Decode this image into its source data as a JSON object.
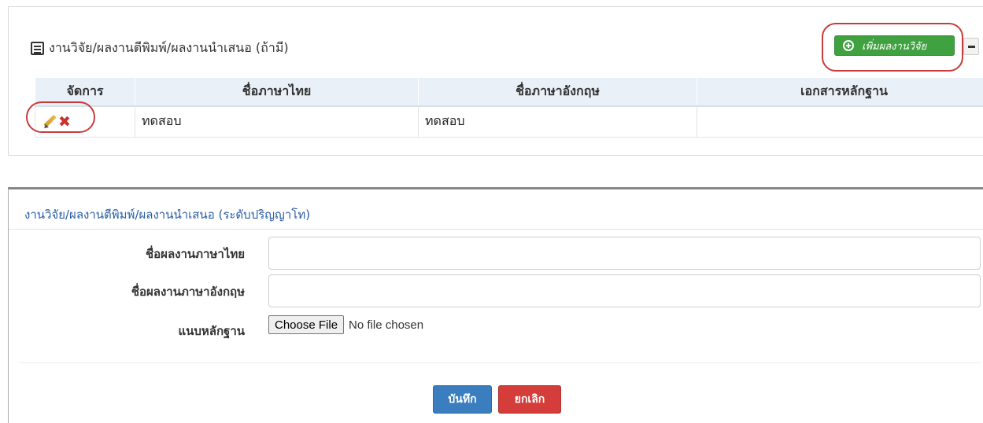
{
  "panel": {
    "title": "งานวิจัย/ผลงานตีพิมพ์/ผลงานนำเสนอ (ถ้ามี)",
    "add_button_label": "เพิ่มผลงานวิจัย",
    "table": {
      "headers": [
        "จัดการ",
        "ชื่อภาษาไทย",
        "ชื่อภาษาอังกฤษ",
        "เอกสารหลักฐาน"
      ],
      "rows": [
        {
          "thai_name": "ทดสอบ",
          "english_name": "ทดสอบ",
          "evidence": ""
        }
      ]
    }
  },
  "modal": {
    "title": "งานวิจัย/ผลงานตีพิมพ์/ผลงานนำเสนอ (ระดับปริญญาโท)",
    "fields": {
      "thai_name_label": "ชื่อผลงานภาษาไทย",
      "thai_name_value": "",
      "english_name_label": "ชื่อผลงานภาษาอังกฤษ",
      "english_name_value": "",
      "attachment_label": "แนบหลักฐาน",
      "file_button_label": "Choose File",
      "file_status": "No file chosen"
    },
    "save_label": "บันทึก",
    "cancel_label": "ยกเลิก"
  },
  "colors": {
    "add_button": "#3fa140",
    "save_button": "#3b7ec0",
    "cancel_button": "#d43d3a",
    "annotation_ring": "#c83b3b",
    "modal_title": "#2a5da8"
  },
  "icons": [
    "document-icon",
    "plus-circle-icon",
    "minus-icon",
    "pencil-icon",
    "delete-x-icon"
  ]
}
